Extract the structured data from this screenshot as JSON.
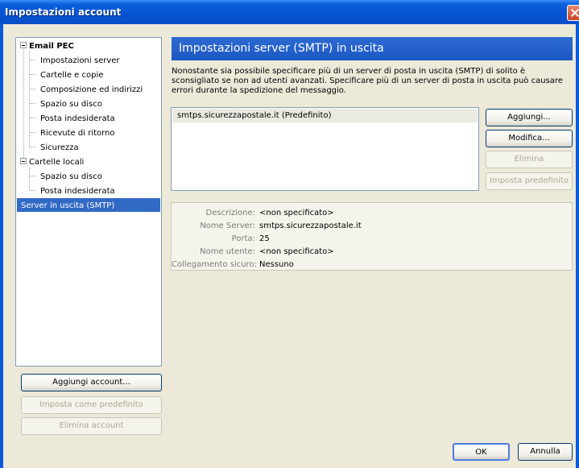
{
  "window": {
    "title": "Impostazioni account"
  },
  "tree": {
    "items": [
      {
        "label": "Email PEC"
      },
      {
        "label": "Impostazioni server"
      },
      {
        "label": "Cartelle e copie"
      },
      {
        "label": "Composizione ed indirizzi"
      },
      {
        "label": "Spazio su disco"
      },
      {
        "label": "Posta indesiderata"
      },
      {
        "label": "Ricevute di ritorno"
      },
      {
        "label": "Sicurezza"
      },
      {
        "label": "Cartelle locali"
      },
      {
        "label": "Spazio su disco"
      },
      {
        "label": "Posta indesiderata"
      },
      {
        "label": "Server in uscita (SMTP)"
      }
    ]
  },
  "left_buttons": {
    "add_account": "Aggiungi account...",
    "set_default": "Imposta come predefinito",
    "delete_account": "Elimina account"
  },
  "panel": {
    "title": "Impostazioni server (SMTP) in uscita",
    "description": "Nonostante sia possibile specificare più di un server di posta in uscita (SMTP) di solito è sconsigliato se non ad utenti avanzati. Specificare più di un server di posta in uscita può causare errori durante la spedizione del messaggio.",
    "servers": [
      "smtps.sicurezzapostale.it (Predefinito)"
    ],
    "buttons": {
      "add": "Aggiungi...",
      "edit": "Modifica...",
      "delete": "Elimina",
      "set_default": "Imposta predefinito"
    },
    "details": {
      "description_label": "Descrizione:",
      "description_value": "<non specificato>",
      "server_label": "Nome Server:",
      "server_value": "smtps.sicurezzapostale.it",
      "port_label": "Porta:",
      "port_value": "25",
      "user_label": "Nome utente:",
      "user_value": "<non specificato>",
      "secure_label": "Collegamento sicuro:",
      "secure_value": "Nessuno"
    }
  },
  "footer": {
    "ok": "OK",
    "cancel": "Annulla"
  }
}
